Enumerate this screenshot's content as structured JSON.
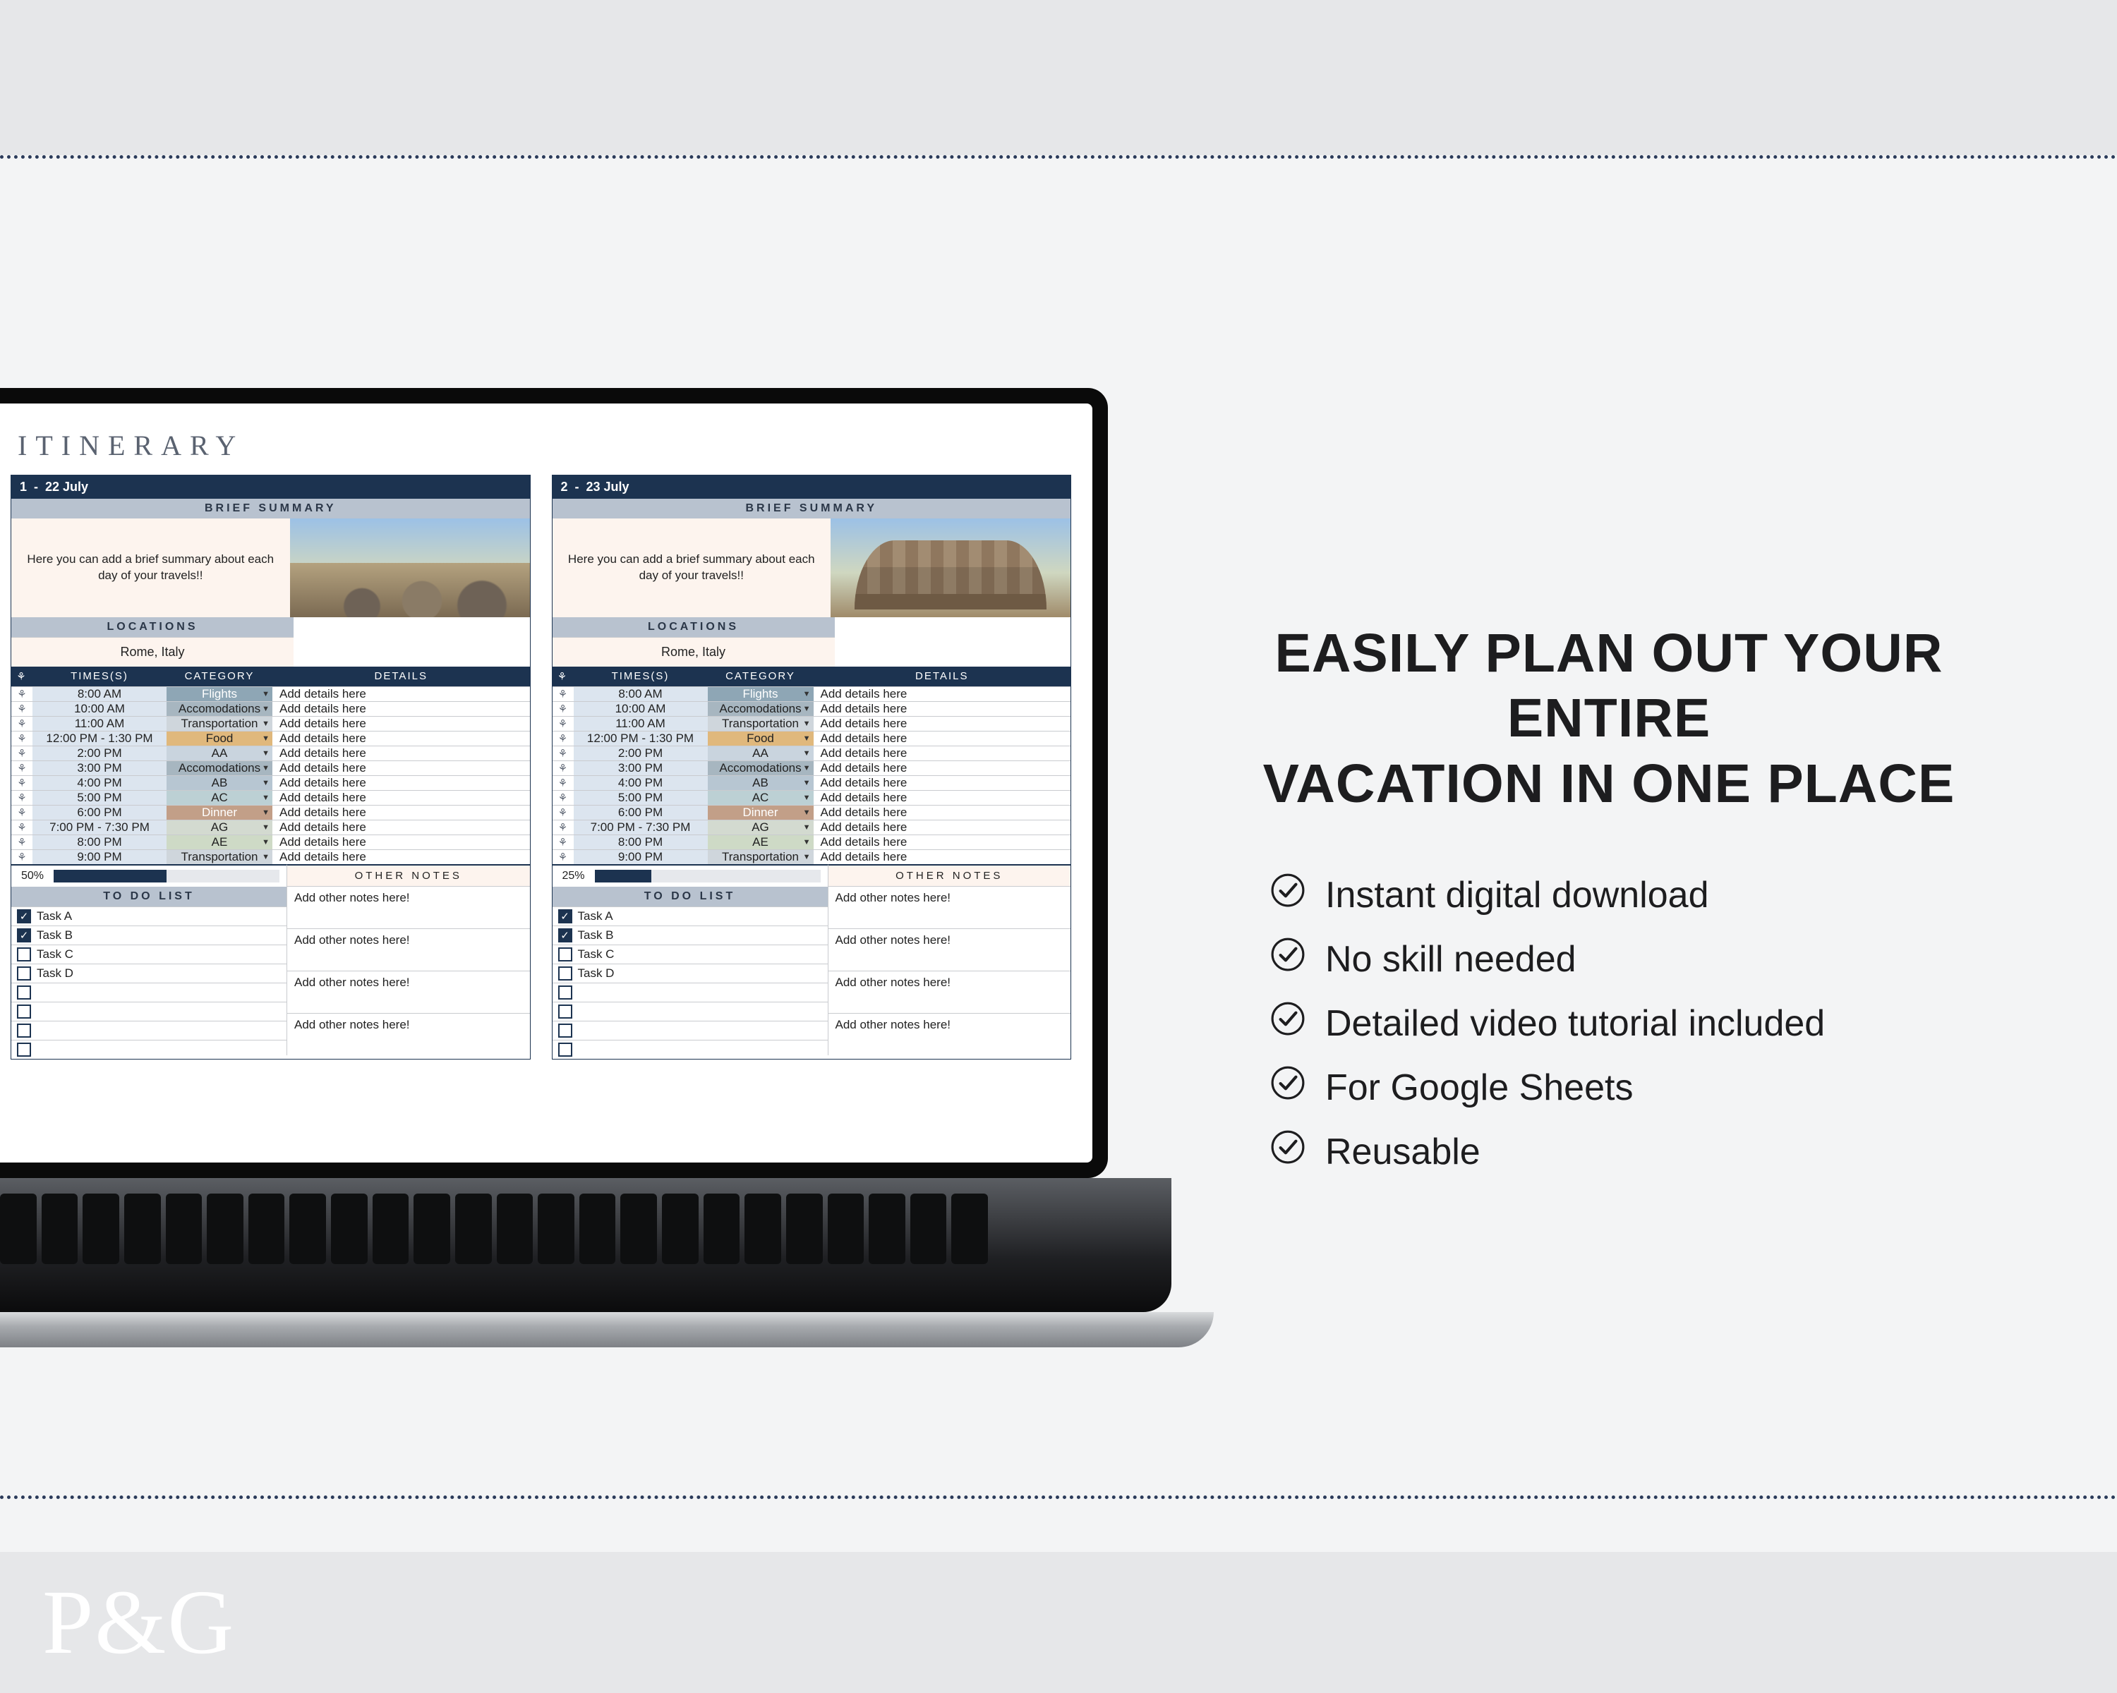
{
  "brand": "P&G",
  "promo": {
    "headline_l1": "EASILY PLAN OUT YOUR ENTIRE",
    "headline_l2": "VACATION IN ONE PLACE",
    "benefits": [
      "Instant digital download",
      "No skill needed",
      "Detailed video tutorial included",
      "For Google Sheets",
      "Reusable"
    ]
  },
  "spreadsheet": {
    "title": "ITINERARY",
    "section_labels": {
      "brief_summary": "BRIEF SUMMARY",
      "locations": "LOCATIONS",
      "times": "TIMES(S)",
      "category": "CATEGORY",
      "details": "DETAILS",
      "to_do": "TO DO LIST",
      "other_notes": "OTHER NOTES"
    },
    "summary_placeholder": "Here you can add a brief summary about each day of your travels!!",
    "details_placeholder": "Add details here",
    "notes_placeholder": "Add other notes here!",
    "days": [
      {
        "day_num": "1",
        "date": "22 July",
        "location": "Rome, Italy",
        "photo": "rome",
        "progress_pct": "50%",
        "progress_fill": 50,
        "schedule": [
          {
            "time": "8:00 AM",
            "category": "Flights"
          },
          {
            "time": "10:00 AM",
            "category": "Accomodations"
          },
          {
            "time": "11:00 AM",
            "category": "Transportation"
          },
          {
            "time": "12:00 PM - 1:30 PM",
            "category": "Food"
          },
          {
            "time": "2:00 PM",
            "category": "AA"
          },
          {
            "time": "3:00 PM",
            "category": "Accomodations"
          },
          {
            "time": "4:00 PM",
            "category": "AB"
          },
          {
            "time": "5:00 PM",
            "category": "AC"
          },
          {
            "time": "6:00 PM",
            "category": "Dinner"
          },
          {
            "time": "7:00 PM - 7:30 PM",
            "category": "AG"
          },
          {
            "time": "8:00 PM",
            "category": "AE"
          },
          {
            "time": "9:00 PM",
            "category": "Transportation"
          }
        ],
        "tasks": [
          {
            "label": "Task A",
            "done": true
          },
          {
            "label": "Task B",
            "done": true
          },
          {
            "label": "Task C",
            "done": false
          },
          {
            "label": "Task D",
            "done": false
          },
          {
            "label": "",
            "done": false
          },
          {
            "label": "",
            "done": false
          },
          {
            "label": "",
            "done": false
          },
          {
            "label": "",
            "done": false
          }
        ]
      },
      {
        "day_num": "2",
        "date": "23 July",
        "location": "Rome, Italy",
        "photo": "colo",
        "progress_pct": "25%",
        "progress_fill": 25,
        "schedule": [
          {
            "time": "8:00 AM",
            "category": "Flights"
          },
          {
            "time": "10:00 AM",
            "category": "Accomodations"
          },
          {
            "time": "11:00 AM",
            "category": "Transportation"
          },
          {
            "time": "12:00 PM - 1:30 PM",
            "category": "Food"
          },
          {
            "time": "2:00 PM",
            "category": "AA"
          },
          {
            "time": "3:00 PM",
            "category": "Accomodations"
          },
          {
            "time": "4:00 PM",
            "category": "AB"
          },
          {
            "time": "5:00 PM",
            "category": "AC"
          },
          {
            "time": "6:00 PM",
            "category": "Dinner"
          },
          {
            "time": "7:00 PM - 7:30 PM",
            "category": "AG"
          },
          {
            "time": "8:00 PM",
            "category": "AE"
          },
          {
            "time": "9:00 PM",
            "category": "Transportation"
          }
        ],
        "tasks": [
          {
            "label": "Task A",
            "done": true
          },
          {
            "label": "Task B",
            "done": true
          },
          {
            "label": "Task C",
            "done": false
          },
          {
            "label": "Task D",
            "done": false
          },
          {
            "label": "",
            "done": false
          },
          {
            "label": "",
            "done": false
          },
          {
            "label": "",
            "done": false
          },
          {
            "label": "",
            "done": false
          }
        ]
      }
    ]
  }
}
